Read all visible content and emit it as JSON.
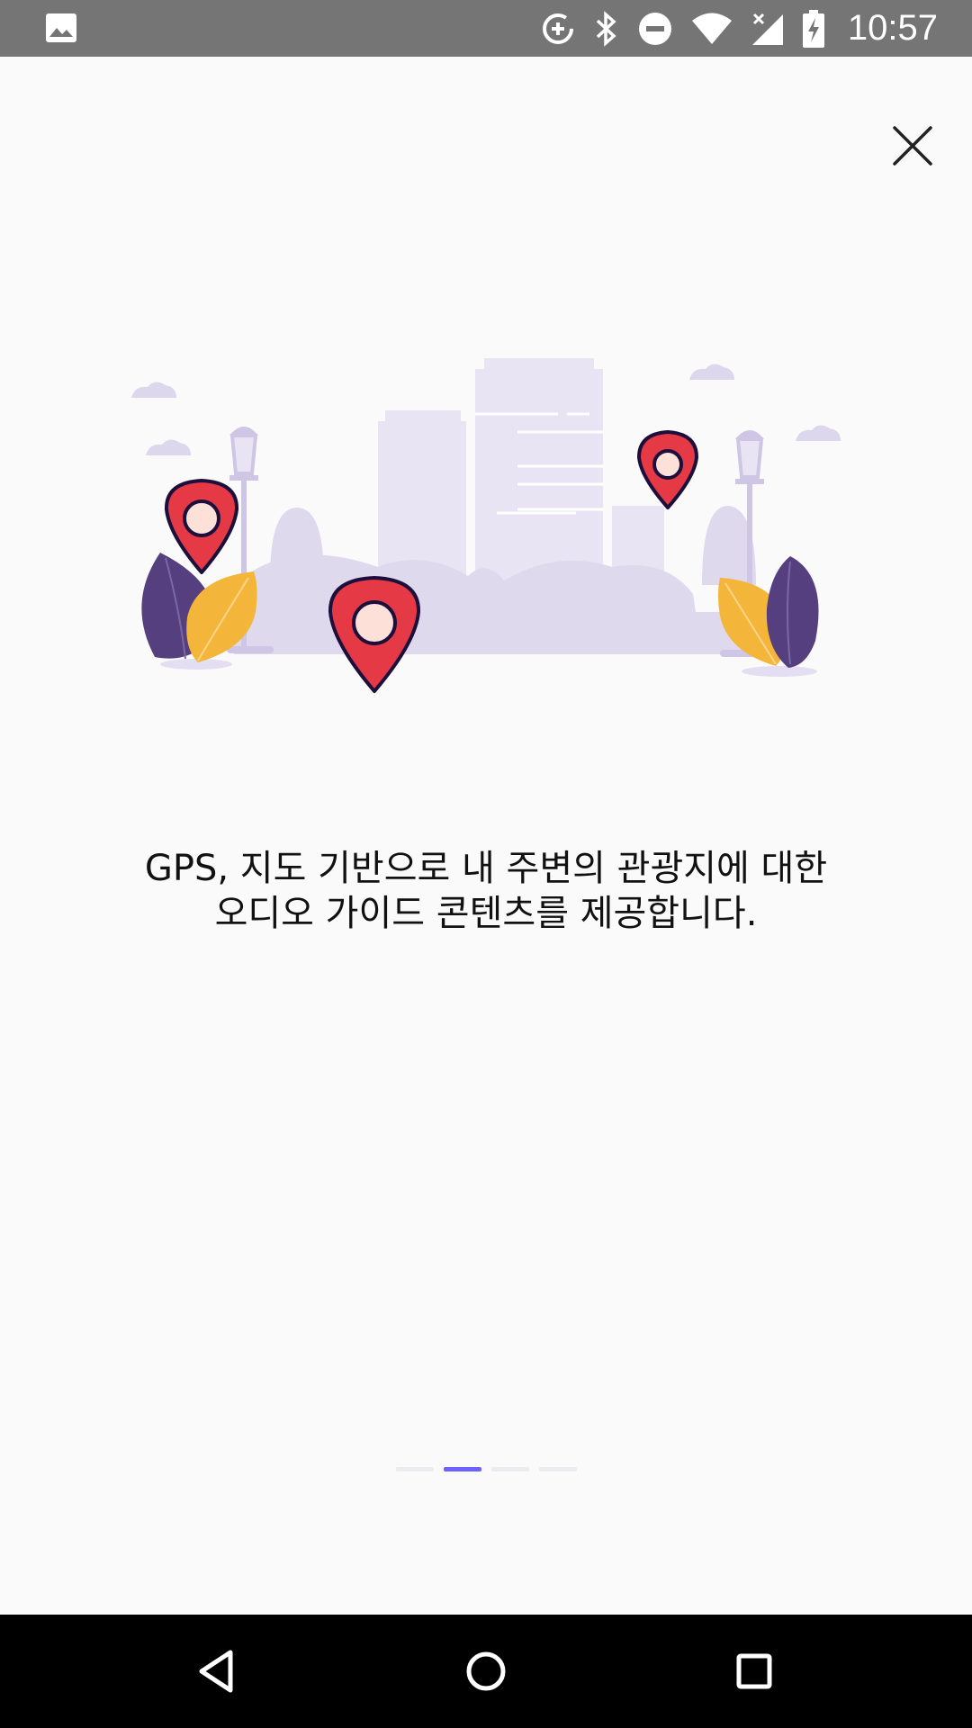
{
  "status_bar": {
    "time": "10:57",
    "icons": [
      "image-icon",
      "data-saver-icon",
      "bluetooth-icon",
      "do-not-disturb-icon",
      "wifi-icon",
      "cell-signal-off-icon",
      "battery-charging-icon"
    ]
  },
  "onboarding": {
    "description_line1": "GPS, 지도 기반으로 내 주변의 관광지에 대한",
    "description_line2": "오디오 가이드 콘텐츠를 제공합니다.",
    "page_count": 4,
    "current_page": 2
  },
  "colors": {
    "accent": "#6c63ff",
    "pin_red": "#e63946",
    "leaf_purple": "#553f7e",
    "leaf_yellow": "#f4b63a",
    "city_lavender": "#e2dcf0"
  }
}
